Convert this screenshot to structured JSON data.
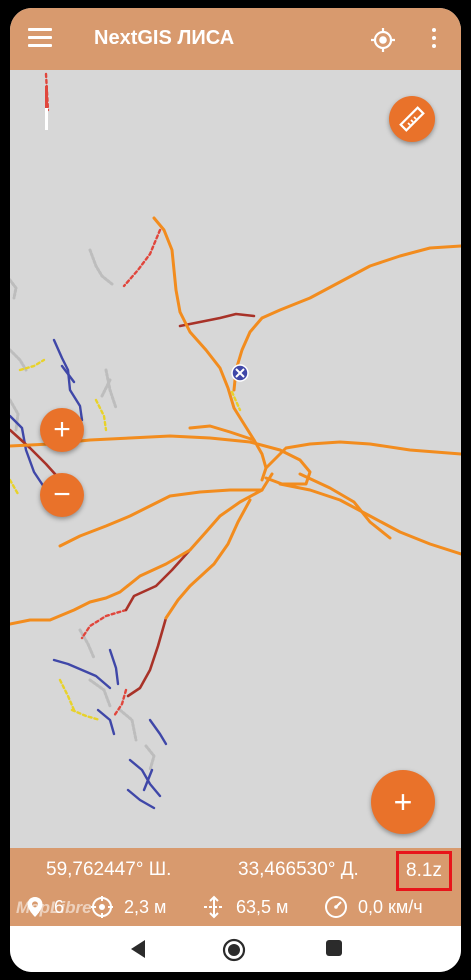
{
  "app": {
    "title": "NextGIS ЛИСА"
  },
  "icons": {
    "menu": "hamburger-menu-icon",
    "locate": "gps-locate-icon",
    "more": "more-vert-icon",
    "ruler": "ruler-icon",
    "zoom_in": "plus-icon",
    "zoom_out": "minus-icon",
    "add": "plus-icon",
    "marker": "location-pin-icon",
    "accuracy": "crosshair-icon",
    "altitude": "altitude-icon",
    "speed": "speedometer-icon"
  },
  "map": {
    "zoom_in_label": "+",
    "zoom_out_label": "−",
    "add_label": "+",
    "attribution": "MapLibre"
  },
  "status": {
    "latitude": "59,762447° Ш.",
    "longitude": "33,466530° Д.",
    "zoom": "8.1z",
    "satellites": "6",
    "accuracy": "2,3 м",
    "altitude": "63,5 м",
    "speed": "0,0 км/ч"
  },
  "colors": {
    "toolbar": "#d89a6e",
    "accent": "#e9722a",
    "map_background": "#d7d7d7",
    "road_main": "#f28c1e",
    "road_dirt": "#a83228",
    "trail_blue": "#3f47a8",
    "highlight": "#e8141a"
  }
}
